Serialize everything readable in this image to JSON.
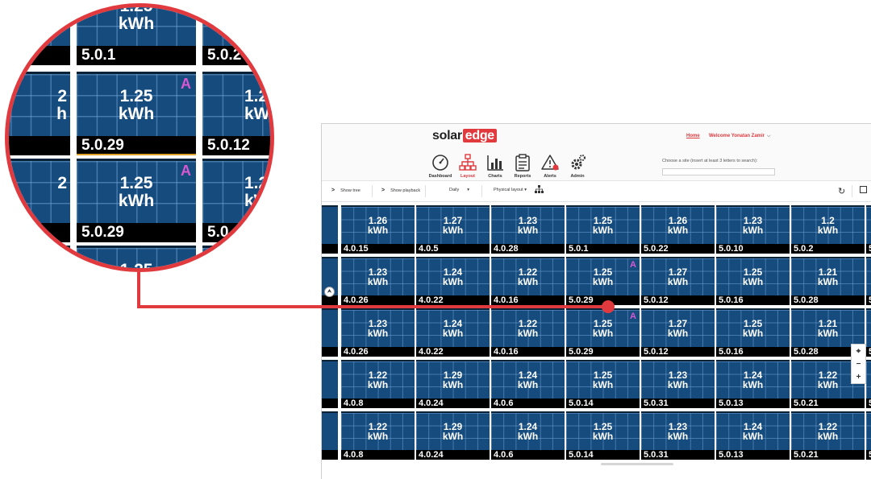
{
  "header": {
    "logo_solar": "solar",
    "logo_edge": "edge",
    "home_link": "Home",
    "welcome": "Welcome Yonatan Zamir",
    "welcome_chevron": "⌵"
  },
  "nav": [
    {
      "label": "Dashboard",
      "icon": "gauge-icon",
      "active": false
    },
    {
      "label": "Layout",
      "icon": "layout-tree-icon",
      "active": true
    },
    {
      "label": "Charts",
      "icon": "bar-chart-icon",
      "active": false
    },
    {
      "label": "Reports",
      "icon": "clipboard-icon",
      "active": false
    },
    {
      "label": "Alerts",
      "icon": "warning-icon",
      "active": false
    },
    {
      "label": "Admin",
      "icon": "gears-icon",
      "active": false
    }
  ],
  "search": {
    "label": "Choose a site (insert at least 3 letters to search):",
    "value": ""
  },
  "toolbar": {
    "show_tree": "Show tree",
    "show_playback": "Show playback",
    "period": "Daily",
    "period_caret": "▾",
    "layout_mode": "Physical layout ▾",
    "arrow": ">"
  },
  "grid": {
    "unit": "kWh",
    "alert_marker": "A",
    "rows": [
      [
        {
          "value": "1.26",
          "id": "4.0.15"
        },
        {
          "value": "1.27",
          "id": "4.0.5"
        },
        {
          "value": "1.23",
          "id": "4.0.28"
        },
        {
          "value": "1.25",
          "id": "5.0.1"
        },
        {
          "value": "1.26",
          "id": "5.0.22"
        },
        {
          "value": "1.23",
          "id": "5.0.10"
        },
        {
          "value": "1.2",
          "id": "5.0.2"
        }
      ],
      [
        {
          "value": "1.23",
          "id": "4.0.26"
        },
        {
          "value": "1.24",
          "id": "4.0.22"
        },
        {
          "value": "1.22",
          "id": "4.0.16"
        },
        {
          "value": "1.25",
          "id": "5.0.29",
          "alert": true
        },
        {
          "value": "1.27",
          "id": "5.0.12"
        },
        {
          "value": "1.25",
          "id": "5.0.16"
        },
        {
          "value": "1.21",
          "id": "5.0.28"
        }
      ],
      [
        {
          "value": "1.23",
          "id": "4.0.26"
        },
        {
          "value": "1.24",
          "id": "4.0.22"
        },
        {
          "value": "1.22",
          "id": "4.0.16"
        },
        {
          "value": "1.25",
          "id": "5.0.29",
          "alert": true
        },
        {
          "value": "1.27",
          "id": "5.0.12"
        },
        {
          "value": "1.25",
          "id": "5.0.16"
        },
        {
          "value": "1.21",
          "id": "5.0.28"
        }
      ],
      [
        {
          "value": "1.22",
          "id": "4.0.8"
        },
        {
          "value": "1.29",
          "id": "4.0.24"
        },
        {
          "value": "1.24",
          "id": "4.0.6"
        },
        {
          "value": "1.25",
          "id": "5.0.14"
        },
        {
          "value": "1.23",
          "id": "5.0.31"
        },
        {
          "value": "1.24",
          "id": "5.0.13"
        },
        {
          "value": "1.22",
          "id": "5.0.21"
        }
      ],
      [
        {
          "value": "1.22",
          "id": "4.0.8"
        },
        {
          "value": "1.29",
          "id": "4.0.24"
        },
        {
          "value": "1.24",
          "id": "4.0.6"
        },
        {
          "value": "1.25",
          "id": "5.0.14"
        },
        {
          "value": "1.23",
          "id": "5.0.31"
        },
        {
          "value": "1.24",
          "id": "5.0.13"
        },
        {
          "value": "1.22",
          "id": "5.0.21"
        }
      ]
    ],
    "edge_ids": [
      "5",
      "5",
      "5",
      "5"
    ]
  },
  "map_controls": {
    "compass": "⮝",
    "locate": "⌖",
    "zoom_out": "−",
    "zoom_in": "+"
  },
  "magnifier": {
    "top_id_left": "5.0.1",
    "top_id_right": "5.0.2",
    "top_partial_value": "1.25",
    "panel_value": "1.25",
    "panel_id": "5.0.29",
    "right_id": "5.0.12",
    "right_partial_value": "1.2",
    "right_partial_unit": "kW",
    "left_partial_value": "2",
    "left_partial_unit": "h",
    "bottom_right_id": "5.0.",
    "bottom_partial_value": "1.25"
  },
  "colors": {
    "accent": "#e03a3e",
    "panel_blue": "#164b7e",
    "alert_magenta": "#d958d2"
  }
}
